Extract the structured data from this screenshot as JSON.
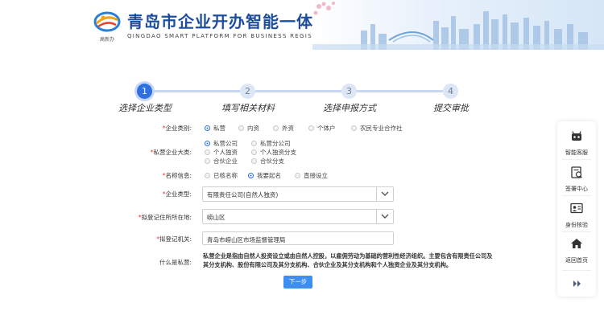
{
  "header": {
    "title": "青岛市企业开办智能一体化平台",
    "subtitle": "QINGDAO SMART PLATFORM FOR BUSINESS REGISTRATION",
    "logo_caption": "高新办"
  },
  "steps": [
    {
      "number": "1",
      "label": "选择企业类型",
      "active": true
    },
    {
      "number": "2",
      "label": "填写相关材料",
      "active": false
    },
    {
      "number": "3",
      "label": "选择申报方式",
      "active": false
    },
    {
      "number": "4",
      "label": "提交审批",
      "active": false
    }
  ],
  "form": {
    "enterprise_category": {
      "label": "企业类别:",
      "options": [
        "私营",
        "内资",
        "外资",
        "个体户",
        "农民专业合作社"
      ],
      "selected": "私营"
    },
    "private_category": {
      "label": "私营企业大类:",
      "options": [
        "私营公司",
        "私营分公司",
        "个人独资",
        "个人独资分支",
        "合伙企业",
        "合伙分支"
      ],
      "selected": "私营公司"
    },
    "name_info": {
      "label": "名称信息:",
      "options": [
        "已核名称",
        "我要起名",
        "直接设立"
      ],
      "selected": "我要起名"
    },
    "enterprise_type": {
      "label": "企业类型:",
      "value": "有限责任公司(自然人独资)"
    },
    "registration_location": {
      "label": "拟登记住所所在地:",
      "value": "崂山区"
    },
    "registration_authority": {
      "label": "拟登记机关:",
      "value": "青岛市崂山区市场监督管理局"
    },
    "what_is_private": {
      "label": "什么是私营:",
      "text": "私营企业是指由自然人投资设立或由自然人控股，以雇佣劳动为基础的营利性经济组织。主要包含有限责任公司及其分支机构、股份有限公司及其分支机构、合伙企业及其分支机构和个人独资企业及其分支机构。"
    },
    "next_button": "下一步"
  },
  "side_panel": {
    "items": [
      {
        "label": "智能客服",
        "icon": "robot-icon"
      },
      {
        "label": "签署中心",
        "icon": "sign-icon"
      },
      {
        "label": "身份核验",
        "icon": "id-card-icon"
      },
      {
        "label": "返回首页",
        "icon": "home-icon"
      }
    ],
    "collapse_icon": "double-chevron-right-icon"
  },
  "colors": {
    "brand_blue": "#1d4e9e",
    "accent": "#2f6fe0",
    "button": "#3d8ef0",
    "required": "#e33333"
  }
}
